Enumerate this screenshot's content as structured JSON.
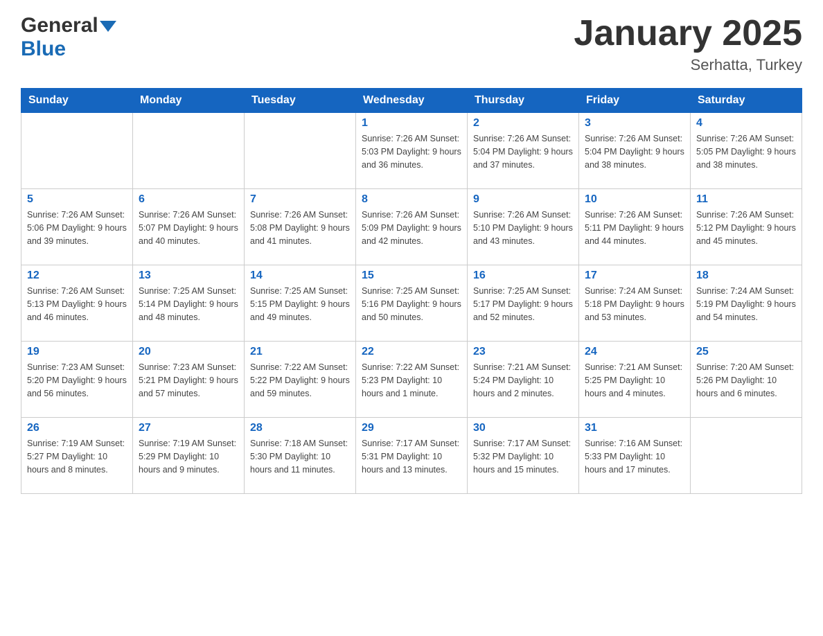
{
  "header": {
    "logo_general": "General",
    "logo_blue": "Blue",
    "title": "January 2025",
    "subtitle": "Serhatta, Turkey"
  },
  "days_of_week": [
    "Sunday",
    "Monday",
    "Tuesday",
    "Wednesday",
    "Thursday",
    "Friday",
    "Saturday"
  ],
  "weeks": [
    {
      "cells": [
        {
          "day": "",
          "info": ""
        },
        {
          "day": "",
          "info": ""
        },
        {
          "day": "",
          "info": ""
        },
        {
          "day": "1",
          "info": "Sunrise: 7:26 AM\nSunset: 5:03 PM\nDaylight: 9 hours and 36 minutes."
        },
        {
          "day": "2",
          "info": "Sunrise: 7:26 AM\nSunset: 5:04 PM\nDaylight: 9 hours and 37 minutes."
        },
        {
          "day": "3",
          "info": "Sunrise: 7:26 AM\nSunset: 5:04 PM\nDaylight: 9 hours and 38 minutes."
        },
        {
          "day": "4",
          "info": "Sunrise: 7:26 AM\nSunset: 5:05 PM\nDaylight: 9 hours and 38 minutes."
        }
      ]
    },
    {
      "cells": [
        {
          "day": "5",
          "info": "Sunrise: 7:26 AM\nSunset: 5:06 PM\nDaylight: 9 hours and 39 minutes."
        },
        {
          "day": "6",
          "info": "Sunrise: 7:26 AM\nSunset: 5:07 PM\nDaylight: 9 hours and 40 minutes."
        },
        {
          "day": "7",
          "info": "Sunrise: 7:26 AM\nSunset: 5:08 PM\nDaylight: 9 hours and 41 minutes."
        },
        {
          "day": "8",
          "info": "Sunrise: 7:26 AM\nSunset: 5:09 PM\nDaylight: 9 hours and 42 minutes."
        },
        {
          "day": "9",
          "info": "Sunrise: 7:26 AM\nSunset: 5:10 PM\nDaylight: 9 hours and 43 minutes."
        },
        {
          "day": "10",
          "info": "Sunrise: 7:26 AM\nSunset: 5:11 PM\nDaylight: 9 hours and 44 minutes."
        },
        {
          "day": "11",
          "info": "Sunrise: 7:26 AM\nSunset: 5:12 PM\nDaylight: 9 hours and 45 minutes."
        }
      ]
    },
    {
      "cells": [
        {
          "day": "12",
          "info": "Sunrise: 7:26 AM\nSunset: 5:13 PM\nDaylight: 9 hours and 46 minutes."
        },
        {
          "day": "13",
          "info": "Sunrise: 7:25 AM\nSunset: 5:14 PM\nDaylight: 9 hours and 48 minutes."
        },
        {
          "day": "14",
          "info": "Sunrise: 7:25 AM\nSunset: 5:15 PM\nDaylight: 9 hours and 49 minutes."
        },
        {
          "day": "15",
          "info": "Sunrise: 7:25 AM\nSunset: 5:16 PM\nDaylight: 9 hours and 50 minutes."
        },
        {
          "day": "16",
          "info": "Sunrise: 7:25 AM\nSunset: 5:17 PM\nDaylight: 9 hours and 52 minutes."
        },
        {
          "day": "17",
          "info": "Sunrise: 7:24 AM\nSunset: 5:18 PM\nDaylight: 9 hours and 53 minutes."
        },
        {
          "day": "18",
          "info": "Sunrise: 7:24 AM\nSunset: 5:19 PM\nDaylight: 9 hours and 54 minutes."
        }
      ]
    },
    {
      "cells": [
        {
          "day": "19",
          "info": "Sunrise: 7:23 AM\nSunset: 5:20 PM\nDaylight: 9 hours and 56 minutes."
        },
        {
          "day": "20",
          "info": "Sunrise: 7:23 AM\nSunset: 5:21 PM\nDaylight: 9 hours and 57 minutes."
        },
        {
          "day": "21",
          "info": "Sunrise: 7:22 AM\nSunset: 5:22 PM\nDaylight: 9 hours and 59 minutes."
        },
        {
          "day": "22",
          "info": "Sunrise: 7:22 AM\nSunset: 5:23 PM\nDaylight: 10 hours and 1 minute."
        },
        {
          "day": "23",
          "info": "Sunrise: 7:21 AM\nSunset: 5:24 PM\nDaylight: 10 hours and 2 minutes."
        },
        {
          "day": "24",
          "info": "Sunrise: 7:21 AM\nSunset: 5:25 PM\nDaylight: 10 hours and 4 minutes."
        },
        {
          "day": "25",
          "info": "Sunrise: 7:20 AM\nSunset: 5:26 PM\nDaylight: 10 hours and 6 minutes."
        }
      ]
    },
    {
      "cells": [
        {
          "day": "26",
          "info": "Sunrise: 7:19 AM\nSunset: 5:27 PM\nDaylight: 10 hours and 8 minutes."
        },
        {
          "day": "27",
          "info": "Sunrise: 7:19 AM\nSunset: 5:29 PM\nDaylight: 10 hours and 9 minutes."
        },
        {
          "day": "28",
          "info": "Sunrise: 7:18 AM\nSunset: 5:30 PM\nDaylight: 10 hours and 11 minutes."
        },
        {
          "day": "29",
          "info": "Sunrise: 7:17 AM\nSunset: 5:31 PM\nDaylight: 10 hours and 13 minutes."
        },
        {
          "day": "30",
          "info": "Sunrise: 7:17 AM\nSunset: 5:32 PM\nDaylight: 10 hours and 15 minutes."
        },
        {
          "day": "31",
          "info": "Sunrise: 7:16 AM\nSunset: 5:33 PM\nDaylight: 10 hours and 17 minutes."
        },
        {
          "day": "",
          "info": ""
        }
      ]
    }
  ]
}
